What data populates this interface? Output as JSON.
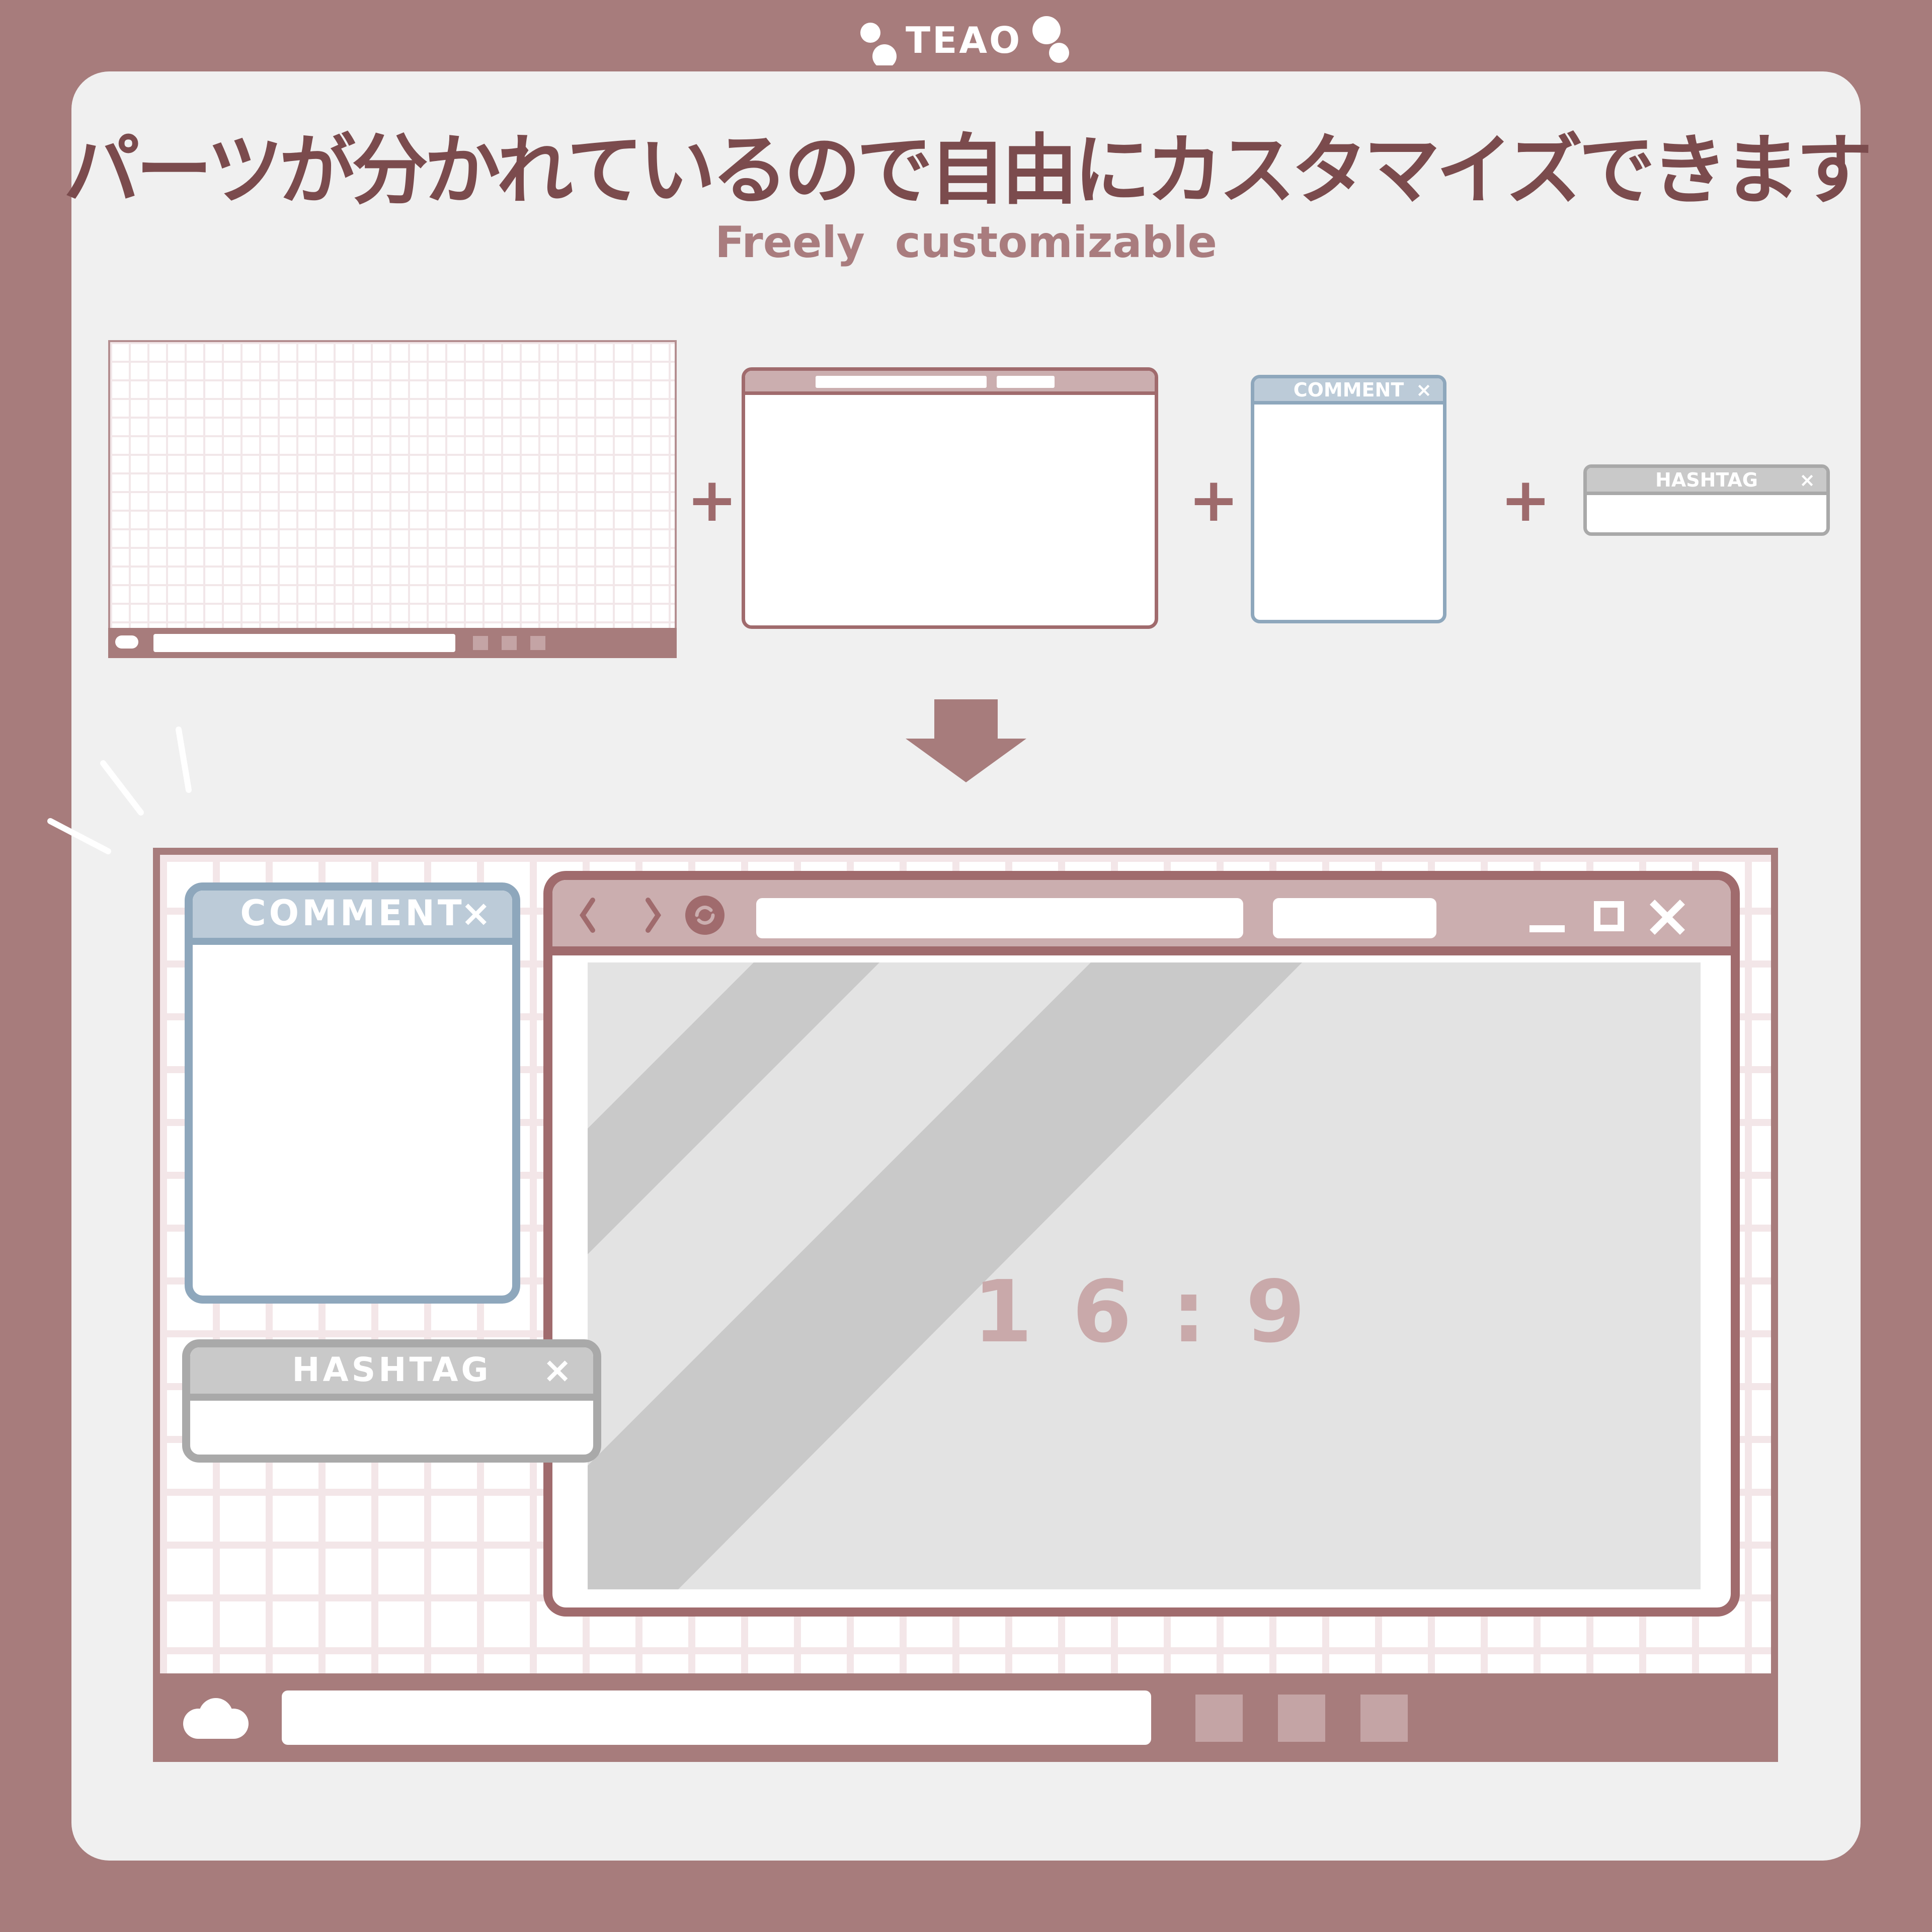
{
  "logo": {
    "text": "TEAO"
  },
  "header": {
    "title": "パーツが分かれているので自由にカスタマイズできます",
    "subtitle": "Freely  customizable"
  },
  "parts": {
    "plus": "+",
    "comment_label": "COMMENT",
    "hashtag_label": "HASHTAG",
    "close": "×"
  },
  "preview": {
    "comment_label": "COMMENT",
    "hashtag_label": "HASHTAG",
    "close": "×",
    "aspect_ratio": "1 6 : 9",
    "nav_back": "‹",
    "nav_forward": "›"
  },
  "colors": {
    "background": "#a77c7c",
    "card": "#f0f0f0",
    "title": "#7b4b4d",
    "browser_border": "#a06b6d",
    "browser_titlebar": "#cbaeaf",
    "comment_border": "#8ea7bc",
    "comment_header": "#bccbd8",
    "hashtag_border": "#a9a9a9",
    "hashtag_header": "#c9c9c9",
    "screen": "#e3e3e3",
    "stripes": "#c9c9c9",
    "aspect_text": "#c9a9aa"
  }
}
